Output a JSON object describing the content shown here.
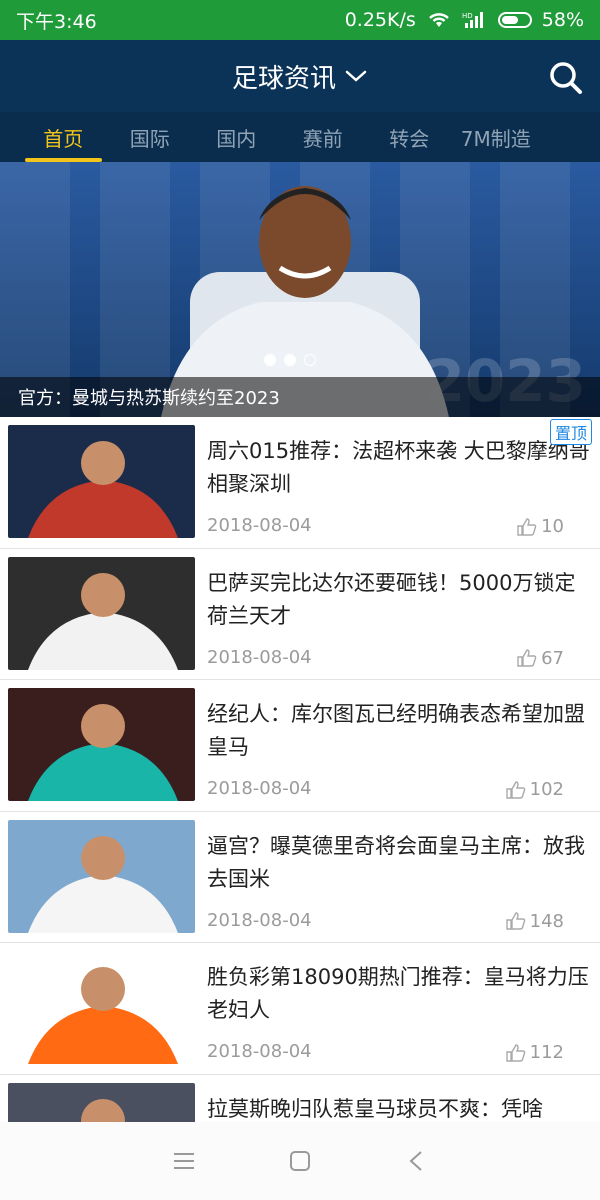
{
  "status": {
    "time": "下午3:46",
    "speed": "0.25K/s",
    "battery": "58%",
    "battery_level": 0.58
  },
  "header": {
    "title": "足球资讯",
    "icons": [
      "chevron-down-icon",
      "search-icon"
    ]
  },
  "tabs": [
    {
      "label": "首页",
      "active": true
    },
    {
      "label": "国际",
      "active": false
    },
    {
      "label": "国内",
      "active": false
    },
    {
      "label": "赛前",
      "active": false
    },
    {
      "label": "转会",
      "active": false
    },
    {
      "label": "7M制造",
      "active": false
    }
  ],
  "banner": {
    "caption": "官方：曼城与热苏斯续约至2023",
    "page_count": 3,
    "active_page": 3
  },
  "news": [
    {
      "title": "周六015推荐：法超杯来袭 大巴黎摩纳哥相聚深圳",
      "date": "2018-08-04",
      "likes": "10",
      "badge": "置顶"
    },
    {
      "title": "巴萨买完比达尔还要砸钱！5000万锁定荷兰天才",
      "date": "2018-08-04",
      "likes": "67"
    },
    {
      "title": "经纪人：库尔图瓦已经明确表态希望加盟皇马",
      "date": "2018-08-04",
      "likes": "102"
    },
    {
      "title": "逼宫？曝莫德里奇将会面皇马主席：放我去国米",
      "date": "2018-08-04",
      "likes": "148"
    },
    {
      "title": "胜负彩第18090期热门推荐：皇马将力压老妇人",
      "date": "2018-08-04",
      "likes": "112"
    },
    {
      "title": "拉莫斯晚归队惹皇马球员不爽：凭啥",
      "date": "",
      "likes": ""
    }
  ],
  "colors": {
    "status_bar": "#1f9b3a",
    "header": "#0b3358",
    "tabs_bg": "#0a2c4d",
    "tab_active": "#f3c51b",
    "badge": "#1e88e5"
  },
  "nav": {
    "icons": [
      "menu-icon",
      "home-icon",
      "back-icon"
    ]
  }
}
